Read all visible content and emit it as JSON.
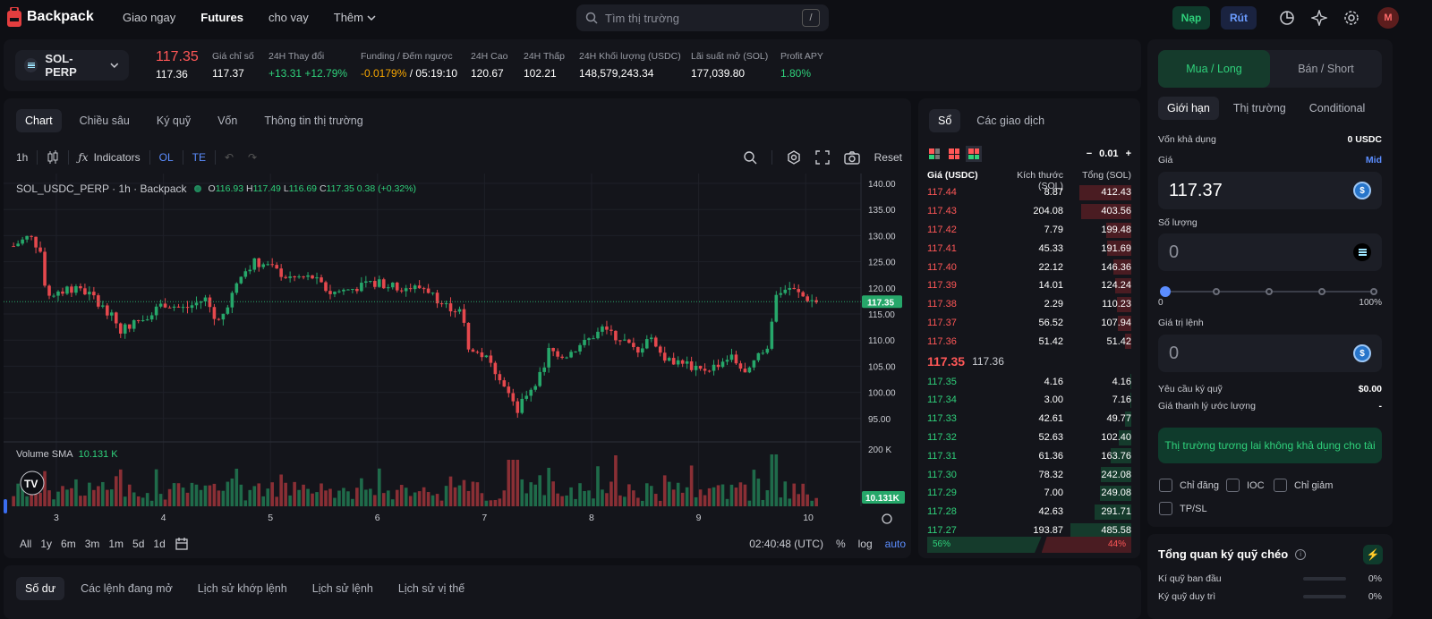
{
  "brand": {
    "name": "Backpack"
  },
  "nav": {
    "spot": "Giao ngay",
    "futures": "Futures",
    "lend": "cho vay",
    "more": "Thêm"
  },
  "search": {
    "placeholder": "Tìm thị trường",
    "shortcut": "/"
  },
  "header": {
    "deposit": "Nạp",
    "withdraw": "Rút",
    "avatar": "M"
  },
  "ticker": {
    "market": "SOL-PERP",
    "last_price": "117.35",
    "mark_price": "117.36",
    "index_label": "Giá chỉ số",
    "index_value": "117.37",
    "change_label": "24H Thay đổi",
    "change_value": "+13.31 +12.79%",
    "funding_label": "Funding / Đếm ngược",
    "funding_rate": "-0.0179%",
    "funding_sep": " / ",
    "funding_countdown": "05:19:10",
    "high_label": "24H Cao",
    "high_value": "120.67",
    "low_label": "24H Thấp",
    "low_value": "102.21",
    "volume_label": "24H Khối lượng (USDC)",
    "volume_value": "148,579,243.34",
    "oi_label": "Lãi suất mở (SOL)",
    "oi_value": "177,039.80",
    "apy_label": "Profit APY",
    "apy_value": "1.80%"
  },
  "chart_tabs": [
    "Chart",
    "Chiều sâu",
    "Ký quỹ",
    "Vốn",
    "Thông tin thị trường"
  ],
  "chart_toolbar": {
    "interval": "1h",
    "indicators": "Indicators",
    "ol": "OL",
    "te": "TE",
    "reset": "Reset"
  },
  "chart_header": {
    "symbol": "SOL_USDC_PERP · 1h · Backpack",
    "o_label": "O",
    "o": "116.93",
    "h_label": "H",
    "h": "117.49",
    "l_label": "L",
    "l": "116.69",
    "c_label": "C",
    "c": "117.35",
    "chg": "0.38 (+0.32%)"
  },
  "volume_header": {
    "label": "Volume SMA",
    "value": "10.131 K"
  },
  "chart_footer": {
    "ranges": [
      "All",
      "1y",
      "6m",
      "3m",
      "1m",
      "5d",
      "1d"
    ],
    "time": "02:40:48 (UTC)",
    "pct": "%",
    "log": "log",
    "auto": "auto"
  },
  "chart_data": {
    "type": "candlestick",
    "symbol": "SOL_USDC_PERP",
    "interval": "1h",
    "x_ticks": [
      "3",
      "4",
      "5",
      "6",
      "7",
      "8",
      "9",
      "10"
    ],
    "y_ticks": [
      140,
      135,
      130,
      125,
      120,
      115,
      110,
      105,
      100,
      95
    ],
    "ylim": [
      92,
      141
    ],
    "last_price_label": "117.35",
    "volume_ticks": [
      "200 K"
    ],
    "volume_last_label": "10.131K",
    "close_path": [
      [
        2.6,
        128
      ],
      [
        2.75,
        130
      ],
      [
        2.85,
        127
      ],
      [
        2.9,
        119
      ],
      [
        2.98,
        118
      ],
      [
        3.1,
        120
      ],
      [
        3.3,
        119
      ],
      [
        3.5,
        115
      ],
      [
        3.6,
        112
      ],
      [
        3.8,
        114
      ],
      [
        4.0,
        117
      ],
      [
        4.2,
        116
      ],
      [
        4.4,
        118
      ],
      [
        4.5,
        113
      ],
      [
        4.65,
        119
      ],
      [
        4.75,
        123
      ],
      [
        4.85,
        125
      ],
      [
        5.0,
        124
      ],
      [
        5.15,
        122
      ],
      [
        5.4,
        122
      ],
      [
        5.55,
        119
      ],
      [
        5.8,
        120
      ],
      [
        6.0,
        121
      ],
      [
        6.2,
        120
      ],
      [
        6.45,
        120
      ],
      [
        6.6,
        117
      ],
      [
        6.8,
        115
      ],
      [
        6.85,
        108
      ],
      [
        7.0,
        107
      ],
      [
        7.1,
        104
      ],
      [
        7.2,
        101
      ],
      [
        7.3,
        96
      ],
      [
        7.4,
        100
      ],
      [
        7.55,
        104
      ],
      [
        7.6,
        108
      ],
      [
        7.75,
        107
      ],
      [
        7.9,
        109
      ],
      [
        8.1,
        112
      ],
      [
        8.3,
        110
      ],
      [
        8.45,
        107
      ],
      [
        8.5,
        111
      ],
      [
        8.6,
        109
      ],
      [
        8.7,
        106
      ],
      [
        8.85,
        106
      ],
      [
        9.0,
        104
      ],
      [
        9.15,
        105
      ],
      [
        9.3,
        107
      ],
      [
        9.45,
        103
      ],
      [
        9.55,
        107
      ],
      [
        9.65,
        108
      ],
      [
        9.72,
        119
      ],
      [
        9.85,
        120
      ],
      [
        10.0,
        118
      ],
      [
        10.1,
        117.35
      ]
    ]
  },
  "orderbook": {
    "tabs": [
      "Sổ",
      "Các giao dịch"
    ],
    "precision": "0.01",
    "headers": [
      "Giá (USDC)",
      "Kích thước (SOL)",
      "Tổng (SOL)"
    ],
    "asks": [
      {
        "price": "117.44",
        "size": "8.87",
        "total": "412.43",
        "depth": 0.85
      },
      {
        "price": "117.43",
        "size": "204.08",
        "total": "403.56",
        "depth": 0.83
      },
      {
        "price": "117.42",
        "size": "7.79",
        "total": "199.48",
        "depth": 0.41
      },
      {
        "price": "117.41",
        "size": "45.33",
        "total": "191.69",
        "depth": 0.39
      },
      {
        "price": "117.40",
        "size": "22.12",
        "total": "146.36",
        "depth": 0.3
      },
      {
        "price": "117.39",
        "size": "14.01",
        "total": "124.24",
        "depth": 0.26
      },
      {
        "price": "117.38",
        "size": "2.29",
        "total": "110.23",
        "depth": 0.23
      },
      {
        "price": "117.37",
        "size": "56.52",
        "total": "107.94",
        "depth": 0.22
      },
      {
        "price": "117.36",
        "size": "51.42",
        "total": "51.42",
        "depth": 0.11
      }
    ],
    "mid_price": "117.35",
    "mid_mark": "117.36",
    "bids": [
      {
        "price": "117.35",
        "size": "4.16",
        "total": "4.16",
        "depth": 0.01
      },
      {
        "price": "117.34",
        "size": "3.00",
        "total": "7.16",
        "depth": 0.02
      },
      {
        "price": "117.33",
        "size": "42.61",
        "total": "49.77",
        "depth": 0.1
      },
      {
        "price": "117.32",
        "size": "52.63",
        "total": "102.40",
        "depth": 0.21
      },
      {
        "price": "117.31",
        "size": "61.36",
        "total": "163.76",
        "depth": 0.34
      },
      {
        "price": "117.30",
        "size": "78.32",
        "total": "242.08",
        "depth": 0.5
      },
      {
        "price": "117.29",
        "size": "7.00",
        "total": "249.08",
        "depth": 0.51
      },
      {
        "price": "117.28",
        "size": "42.63",
        "total": "291.71",
        "depth": 0.6
      },
      {
        "price": "117.27",
        "size": "193.87",
        "total": "485.58",
        "depth": 1.0
      }
    ],
    "buy_ratio": "56%",
    "sell_ratio": "44%"
  },
  "order_form": {
    "buy": "Mua / Long",
    "sell": "Bán / Short",
    "types": [
      "Giới hạn",
      "Thị trường",
      "Conditional"
    ],
    "available_label": "Vốn khả dụng",
    "available_value": "0 USDC",
    "price_label": "Giá",
    "mid": "Mid",
    "price_value": "117.37",
    "qty_label": "Số lượng",
    "qty_value": "0",
    "slider_min": "0",
    "slider_max": "100%",
    "order_value_label": "Giá trị lệnh",
    "order_value": "0",
    "margin_req_label": "Yêu cầu ký quỹ",
    "margin_req_value": "$0.00",
    "liq_label": "Giá thanh lý ước lượng",
    "liq_value": "-",
    "submit": "Thị trường tương lai không khả dụng cho tài",
    "post_only": "Chỉ đăng",
    "ioc": "IOC",
    "reduce_only": "Chỉ giảm",
    "tpsl": "TP/SL"
  },
  "margin_overview": {
    "title": "Tổng quan ký quỹ chéo",
    "initial_label": "Kí quỹ ban đầu",
    "initial_value": "0%",
    "maint_label": "Ký quỹ duy trì",
    "maint_value": "0%"
  },
  "bottom_tabs": [
    "Số dư",
    "Các lệnh đang mở",
    "Lịch sử khớp lệnh",
    "Lịch sử lệnh",
    "Lịch sử vị thế"
  ]
}
